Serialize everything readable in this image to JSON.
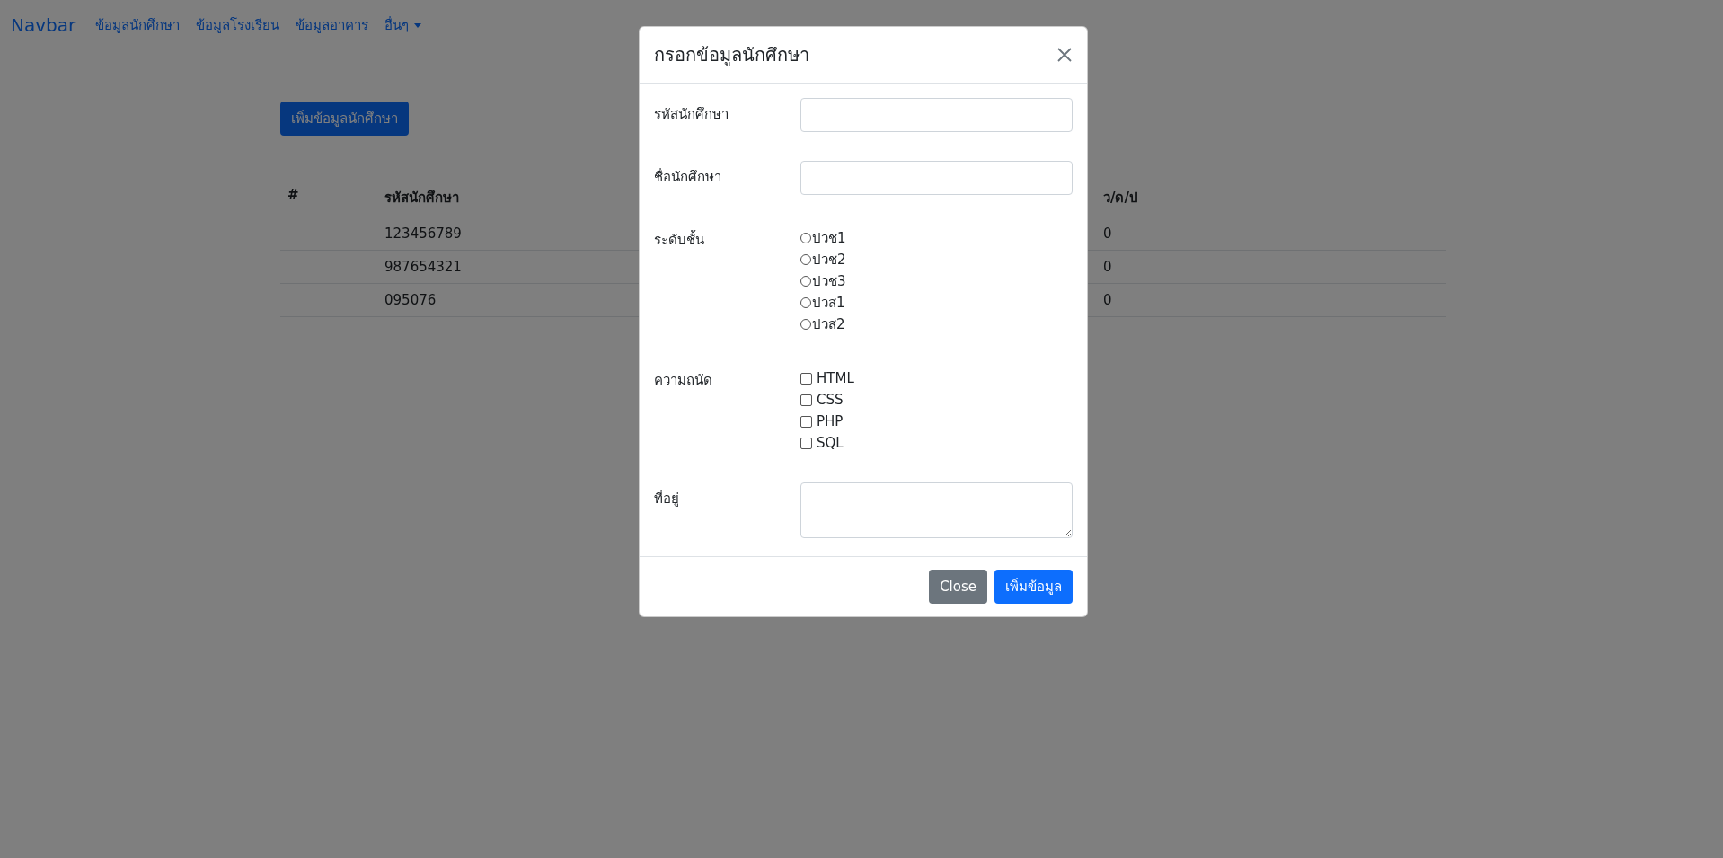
{
  "navbar": {
    "brand": "Navbar",
    "links": [
      {
        "label": "ข้อมูลนักศึกษา",
        "kind": "link"
      },
      {
        "label": "ข้อมูลโรงเรียน",
        "kind": "link"
      },
      {
        "label": "ข้อมูลอาคาร",
        "kind": "link"
      },
      {
        "label": "อื่นๆ",
        "kind": "dropdown"
      }
    ]
  },
  "add_button": "เพิ่มข้อมูลนักศึกษา",
  "table": {
    "columns": [
      "#",
      "รหัสนักศึกษา",
      "ว/ด/ป"
    ],
    "rows": [
      {
        "student_id": "123456789",
        "date": "0"
      },
      {
        "student_id": "987654321",
        "date": "0"
      },
      {
        "student_id": "095076",
        "date": "0"
      }
    ]
  },
  "modal": {
    "title": "กรอกข้อมูลนักศึกษา",
    "fields": [
      {
        "kind": "text",
        "label": "รหัสนักศึกษา"
      },
      {
        "kind": "text",
        "label": "ชื่อนักศึกษา"
      },
      {
        "kind": "radio",
        "label": "ระดับชั้น",
        "options": [
          {
            "label": "ปวช1",
            "selected": false
          },
          {
            "label": "ปวช2",
            "selected": false
          },
          {
            "label": "ปวช3",
            "selected": false
          },
          {
            "label": "ปวส1",
            "selected": false
          },
          {
            "label": "ปวส2",
            "selected": false
          }
        ]
      },
      {
        "kind": "checkbox",
        "label": "ความถนัด",
        "options": [
          {
            "label": "HTML",
            "checked": false
          },
          {
            "label": "CSS",
            "checked": false
          },
          {
            "label": "PHP",
            "checked": false
          },
          {
            "label": "SQL",
            "checked": false
          }
        ]
      },
      {
        "kind": "textarea",
        "label": "ที่อยู่"
      }
    ],
    "buttons": [
      {
        "label": "Close",
        "kind": "secondary"
      },
      {
        "label": "เพิ่มข้อมูล",
        "kind": "primary"
      }
    ]
  }
}
